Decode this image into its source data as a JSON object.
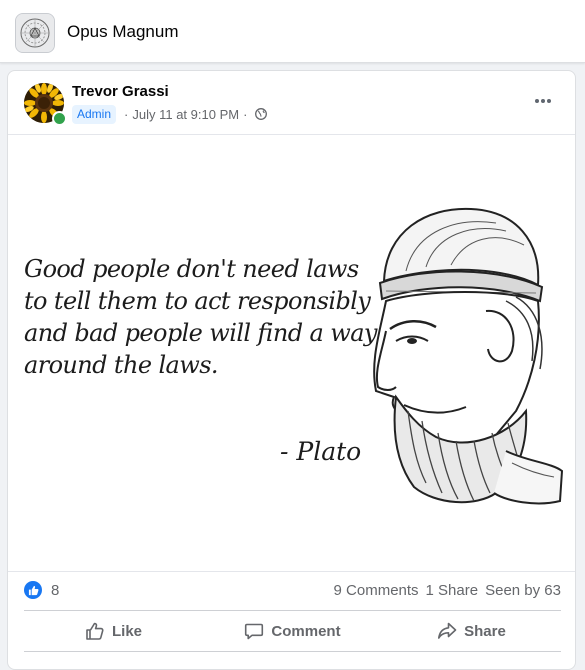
{
  "header": {
    "group_name": "Opus Magnum",
    "logo_icon": "group-emblem-icon"
  },
  "post": {
    "author": "Trevor Grassi",
    "author_online": true,
    "role_badge": "Admin",
    "separator": "·",
    "timestamp": "July 11 at 9:10 PM",
    "privacy_icon": "globe-icon",
    "more_icon": "more-options-icon",
    "image": {
      "quote_lines": [
        "Good people don't need laws",
        "to tell them to act responsibly",
        "and bad people will find a way",
        "around the laws."
      ],
      "attribution": "- Plato"
    },
    "reactions": {
      "like_count": "8",
      "comments": "9 Comments",
      "shares": "1 Share",
      "seen_by": "Seen by 63"
    },
    "actions": {
      "like": "Like",
      "comment": "Comment",
      "share": "Share"
    }
  },
  "colors": {
    "accent": "#1877f2",
    "online": "#31a24c",
    "muted_text": "#65676b",
    "background": "#f0f2f5"
  }
}
